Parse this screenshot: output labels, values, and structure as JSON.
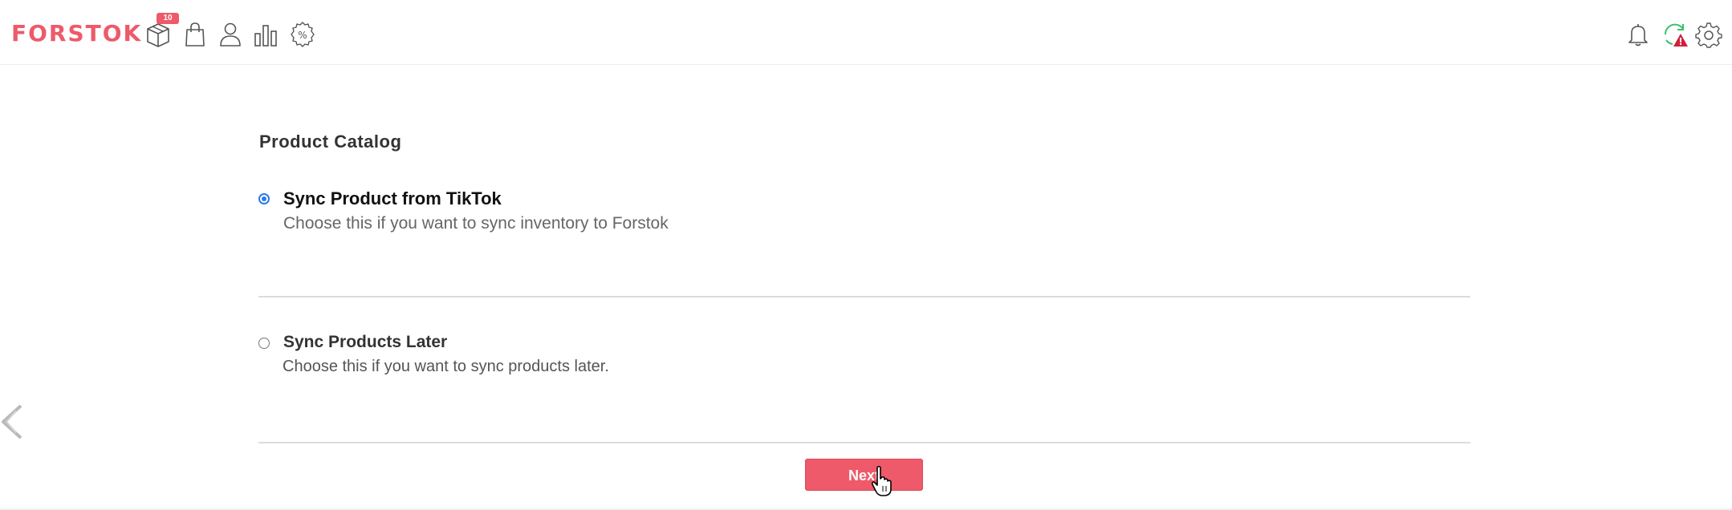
{
  "app": {
    "logo": "FORSTOK",
    "badge": "10"
  },
  "nav": {
    "icons": [
      "box-icon",
      "shopping-bag-icon",
      "user-icon",
      "bar-chart-icon",
      "percent-icon"
    ]
  },
  "header_right": {
    "icons": [
      "bell-icon",
      "sync-warning-icon",
      "gear-icon"
    ]
  },
  "main": {
    "title": "Product Catalog",
    "options": [
      {
        "label": "Sync Product from TikTok",
        "description": "Choose this if you want to sync inventory to Forstok",
        "selected": true
      },
      {
        "label": "Sync Products Later",
        "description": "Choose this if you want to sync products later.",
        "selected": false
      }
    ],
    "next_label": "Next"
  },
  "colors": {
    "brand": "#ee5a6a",
    "radio_selected": "#2a7be4"
  }
}
